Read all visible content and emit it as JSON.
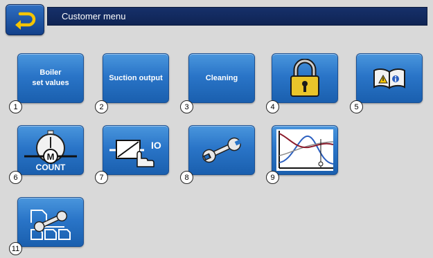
{
  "header": {
    "title": "Customer menu"
  },
  "tiles": [
    {
      "label": "Boiler\nset values",
      "number": "1",
      "icon": "none"
    },
    {
      "label": "Suction output",
      "number": "2",
      "icon": "none"
    },
    {
      "label": "Cleaning",
      "number": "3",
      "icon": "none"
    },
    {
      "label": "",
      "number": "4",
      "icon": "padlock-icon"
    },
    {
      "label": "",
      "number": "5",
      "icon": "manual-book-icon"
    },
    {
      "label": "",
      "number": "6",
      "icon": "motor-counter-icon",
      "icon_text_main": "M",
      "icon_text_sub": "COUNT"
    },
    {
      "label": "",
      "number": "7",
      "icon": "manual-relay-icon",
      "icon_text_main": "IO"
    },
    {
      "label": "",
      "number": "8",
      "icon": "wrench-icon"
    },
    {
      "label": "",
      "number": "9",
      "icon": "heating-curve-icon"
    },
    {
      "label": "",
      "number": "11",
      "icon": "system-config-icon"
    }
  ],
  "colors": {
    "tile": "#2a75c8",
    "titlebar": "#16306a",
    "background": "#d9d9d9",
    "back_arrow": "#f5c400"
  }
}
